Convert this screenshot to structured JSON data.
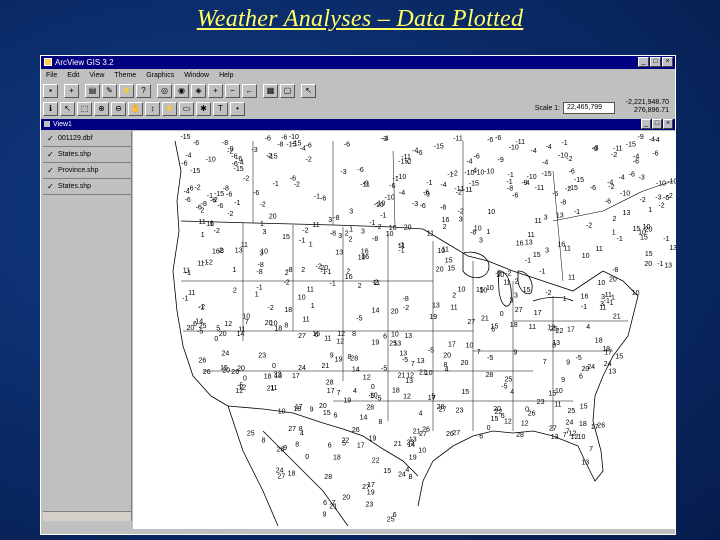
{
  "slide": {
    "title": "Weather Analyses – Data Plotted"
  },
  "app": {
    "title": "ArcView GIS 3.2",
    "window_buttons": [
      "_",
      "□",
      "×"
    ],
    "menu": [
      "File",
      "Edit",
      "View",
      "Theme",
      "Graphics",
      "Window",
      "Help"
    ],
    "scale_label": "Scale 1:",
    "scale_value": "22,465,799",
    "coord_x": "-2,221,948.70",
    "coord_y": "276,896.71"
  },
  "view": {
    "title": "View1",
    "themes": [
      {
        "label": "001129.dbf",
        "checked": true
      },
      {
        "label": "States.shp",
        "checked": true
      },
      {
        "label": "Province.shp",
        "checked": true
      },
      {
        "label": "States.shp",
        "checked": true
      }
    ]
  },
  "icons": {
    "toolbar1": [
      "save-icon",
      "add-theme-icon",
      "theme-properties-icon",
      "edit-legend-icon",
      "hot-link-icon",
      "query-icon",
      "zoom-full-icon",
      "zoom-active-icon",
      "zoom-selected-icon",
      "zoom-in-icon",
      "zoom-out-icon",
      "zoom-previous-icon",
      "select-by-theme-icon",
      "clear-select-icon",
      "help-icon"
    ],
    "toolbar2": [
      "identify-icon",
      "pointer-icon",
      "vertex-edit-icon",
      "zoom-in-tool-icon",
      "zoom-out-tool-icon",
      "pan-icon",
      "measure-icon",
      "hotlink-tool-icon",
      "area-select-icon",
      "label-icon",
      "text-icon",
      "draw-icon"
    ]
  },
  "map_values": [
    "-6",
    "-2",
    "-6",
    "-11",
    "-15",
    "-4",
    "-10",
    "-3",
    "-4",
    "-2",
    "-1",
    "-8",
    "-9",
    "-6",
    "-1",
    "11",
    "-8",
    "2",
    "3",
    "1",
    "-2",
    "16",
    "20",
    "10",
    "15",
    "13",
    "19",
    "11",
    "12",
    "5",
    "8",
    "21",
    "14",
    "22",
    "24",
    "18",
    "17",
    "23",
    "26",
    "25",
    "27",
    "28",
    "7",
    "9",
    "4",
    "6",
    "-5",
    "0"
  ]
}
